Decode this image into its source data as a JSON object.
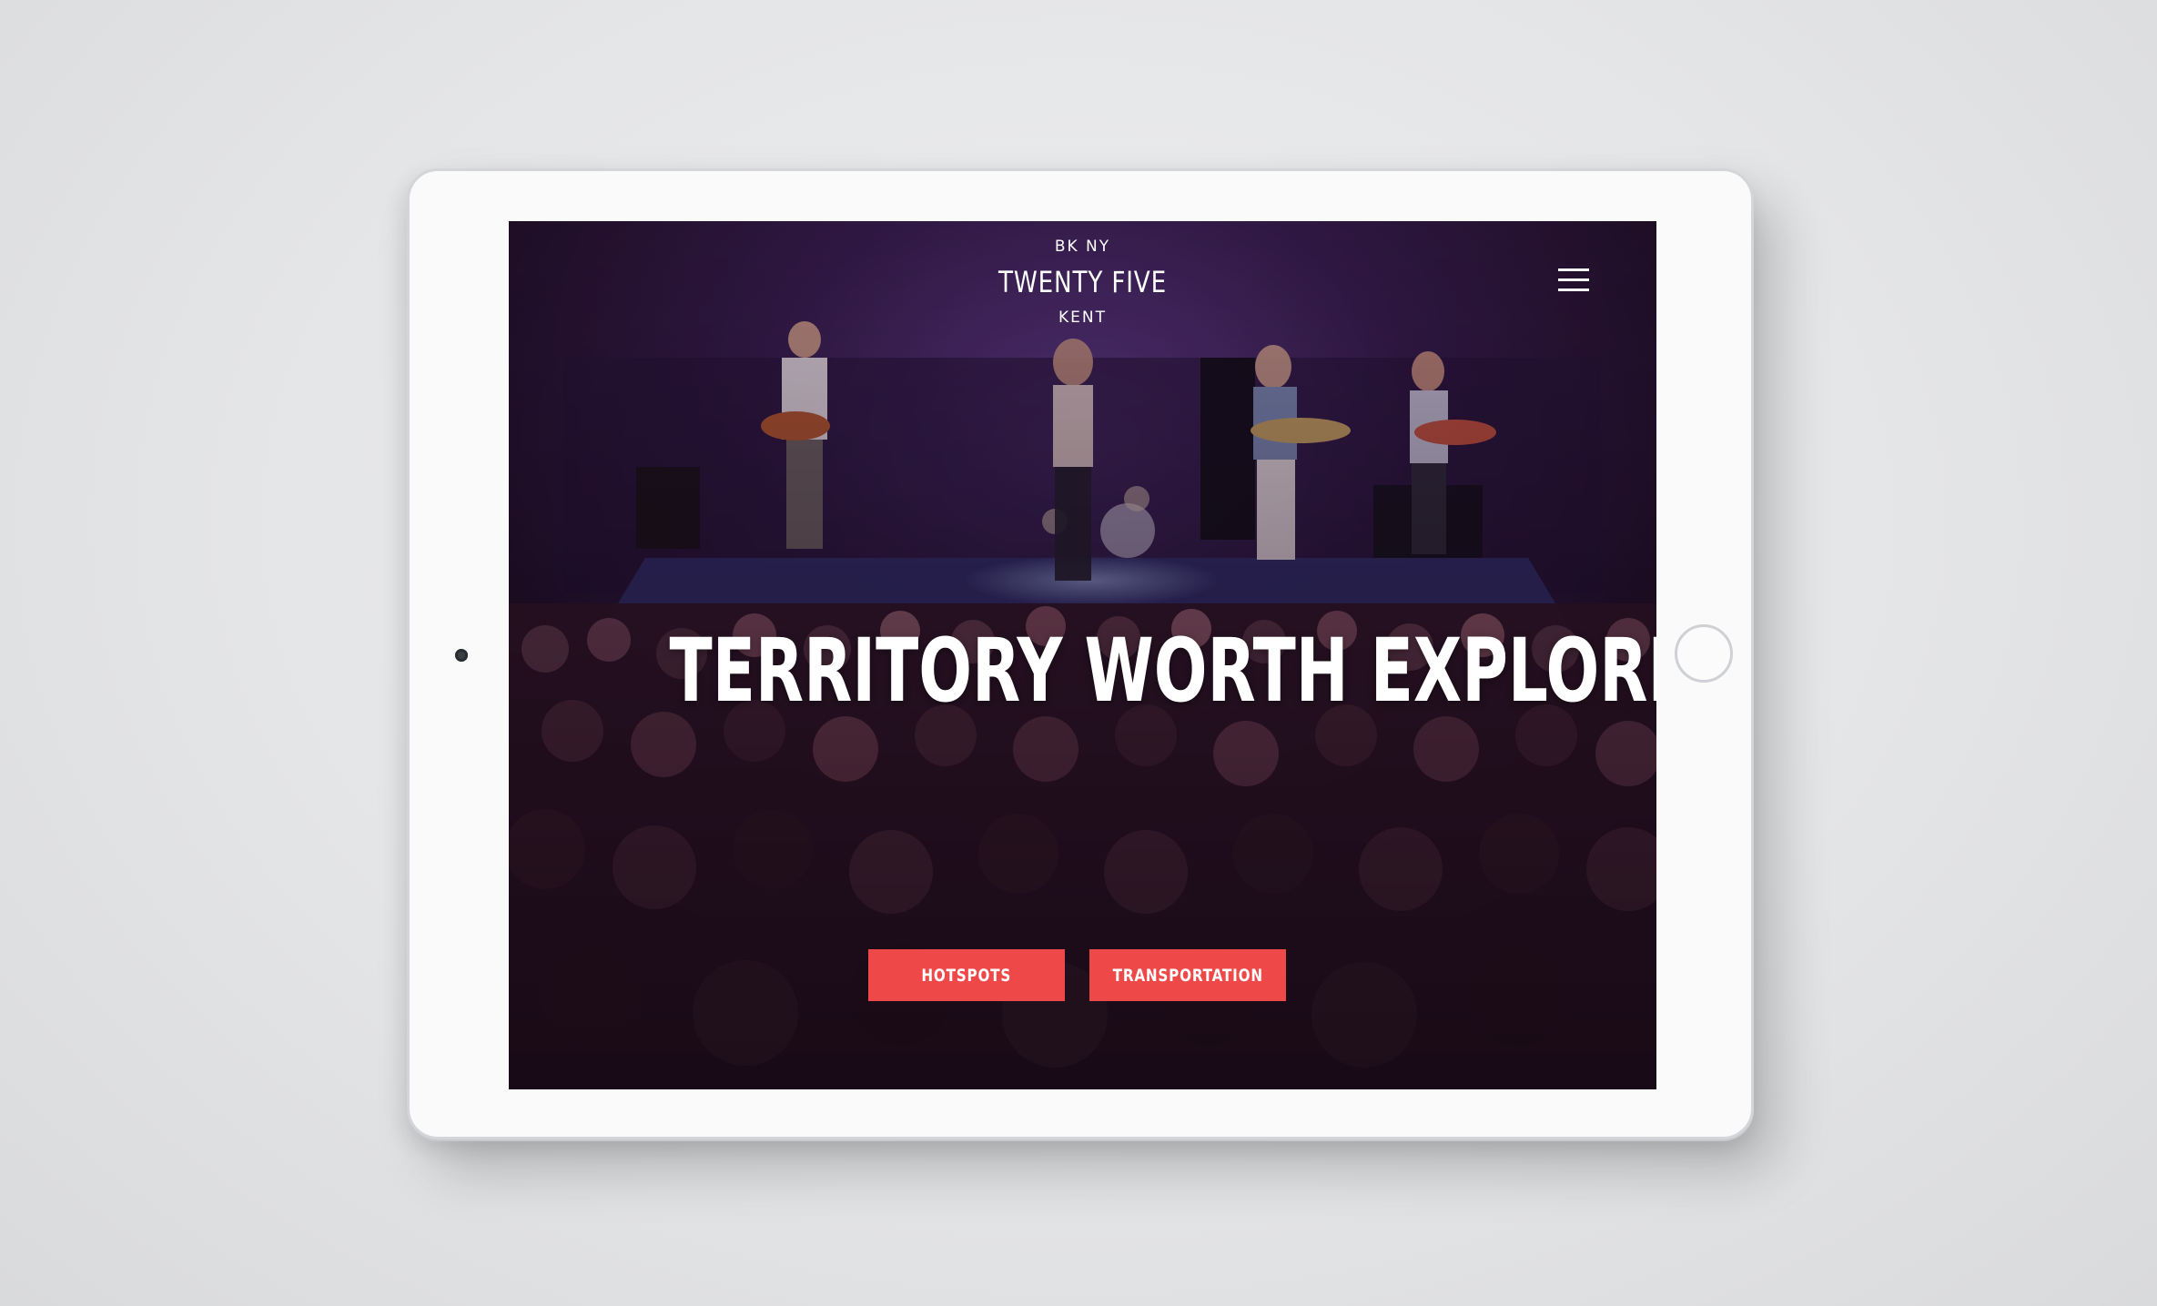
{
  "brand": {
    "line_top": "BK NY",
    "line_main": "TWENTY FIVE",
    "line_bottom": "KENT"
  },
  "nav": {
    "menu_icon": "hamburger-menu-icon"
  },
  "hero": {
    "headline": "TERRITORY WORTH EXPLORING",
    "image": "concert-photo"
  },
  "buttons": {
    "hotspots": "HOTSPOTS",
    "transportation": "TRANSPORTATION"
  },
  "colors": {
    "accent": "#ee4848",
    "text": "#ffffff",
    "device_frame": "#fafafa"
  }
}
